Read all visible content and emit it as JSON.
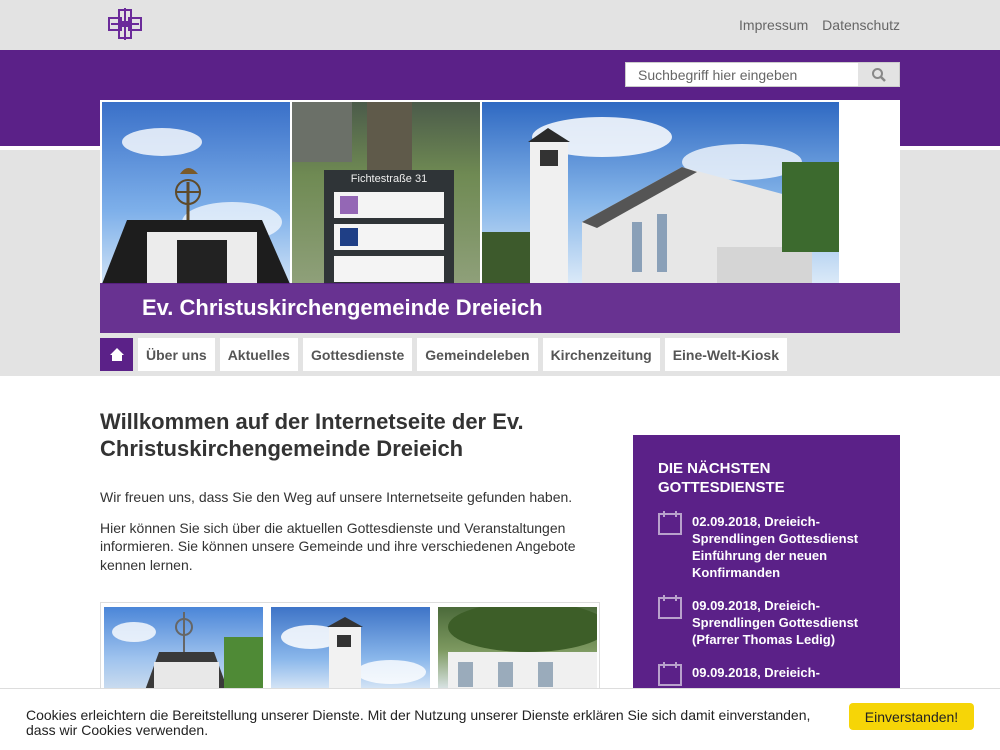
{
  "header": {
    "logo": "cross-logo",
    "links": [
      "Impressum",
      "Datenschutz"
    ]
  },
  "search": {
    "placeholder": "Suchbegriff hier eingeben",
    "icon": "search-icon"
  },
  "banner": {
    "sign_heading": "Fichtestraße 31",
    "title": "Ev. Christuskirchengemeinde Dreieich"
  },
  "nav": {
    "home_icon": "home-icon",
    "items": [
      "Über uns",
      "Aktuelles",
      "Gottesdienste",
      "Gemeindeleben",
      "Kirchenzeitung",
      "Eine-Welt-Kiosk"
    ]
  },
  "main": {
    "heading": "Willkommen auf der Internetseite der Ev. Christuskirchengemeinde Dreieich",
    "paragraphs": [
      "Wir freuen uns, dass Sie den Weg auf unsere Internetseite gefunden haben.",
      "Hier können Sie sich über die aktuellen Gottesdienste und Veranstaltungen informieren. Sie können unsere Gemeinde und ihre verschiedenen Angebote kennen lernen."
    ]
  },
  "sidebar": {
    "heading": "Die nächsten Gottesdienste",
    "events": [
      "02.09.2018, Dreieich-Sprendlingen Gottesdienst Einführung der neuen Konfirmanden",
      "09.09.2018, Dreieich-Sprendlingen Gottesdienst (Pfarrer Thomas Ledig)",
      "09.09.2018, Dreieich-"
    ]
  },
  "cookie": {
    "text": "Cookies erleichtern die Bereitstellung unserer Dienste. Mit der Nutzung unserer Dienste erklären Sie sich damit einverstanden, dass wir Cookies verwenden.",
    "button": "Einverstanden!"
  },
  "colors": {
    "purple": "#5b2188",
    "gray_band": "#e3e3e3",
    "cookie_button": "#f6d507"
  }
}
